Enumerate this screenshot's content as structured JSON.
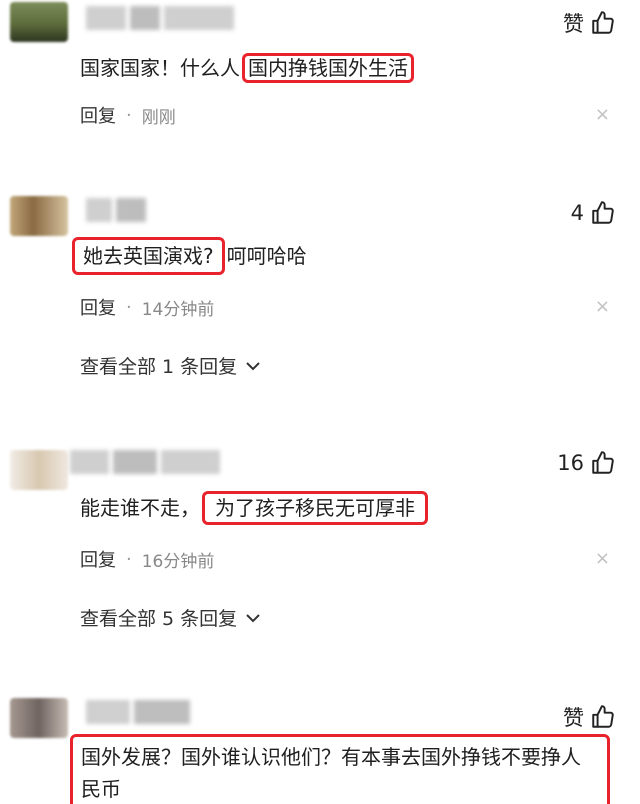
{
  "comments": [
    {
      "likes": "赞",
      "text_plain": "国家国家！什么人",
      "text_highlight": "国内挣钱国外生活",
      "reply_label": "回复",
      "separator": "·",
      "time": "刚刚",
      "close": "×",
      "avatar_colors": [
        "#6b7d4e",
        "#3f4a2a",
        "#a7a35e"
      ]
    },
    {
      "likes": "4",
      "text_highlight": "她去英国演戏?",
      "text_plain": "呵呵哈哈",
      "reply_label": "回复",
      "separator": "·",
      "time": "14分钟前",
      "close": "×",
      "view_replies": "查看全部 1 条回复",
      "avatar_colors": [
        "#b89a6c",
        "#7a5d3a",
        "#d6c3a0"
      ]
    },
    {
      "likes": "16",
      "text_plain": "能走谁不走，",
      "text_highlight": "为了孩子移民无可厚非",
      "reply_label": "回复",
      "separator": "·",
      "time": "16分钟前",
      "close": "×",
      "view_replies": "查看全部 5 条回复",
      "avatar_colors": [
        "#e8e0d6",
        "#c9b89e",
        "#f1ece6"
      ]
    },
    {
      "likes": "赞",
      "text_highlight": "国外发展？国外谁认识他们？有本事去国外挣钱不要挣人民币",
      "avatar_colors": [
        "#9d8f86",
        "#6f6460",
        "#c8bdb5"
      ]
    }
  ]
}
